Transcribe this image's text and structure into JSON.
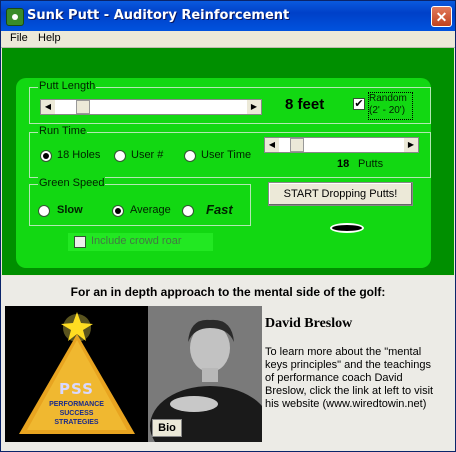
{
  "window": {
    "title": "Sunk Putt - Auditory Reinforcement",
    "close": "✕"
  },
  "menu": {
    "file": "File",
    "help": "Help"
  },
  "putt_length": {
    "group_label": "Putt Length",
    "value_text": "8 feet",
    "slider_fraction": 0.12,
    "random_label_line1": "Random",
    "random_label_line2": "(2' - 20')",
    "random_checked": true
  },
  "run_time": {
    "group_label": "Run Time",
    "options": [
      "18 Holes",
      "User #",
      "User Time"
    ],
    "selected": "18 Holes",
    "putts_count": "18",
    "putts_label": "Putts",
    "slider_fraction": 0.1
  },
  "green_speed": {
    "group_label": "Green Speed",
    "slow": "Slow",
    "average": "Average",
    "fast": "Fast",
    "selected": "Average"
  },
  "start_button": "START Dropping Putts!",
  "crowd_roar": {
    "label": "Include crowd roar",
    "checked": false
  },
  "promo": {
    "headline": "For an in depth approach to the mental side of the golf:",
    "logo_line1": "PSS",
    "logo_line2": "PERFORMANCE",
    "logo_line3": "SUCCESS",
    "logo_line4": "STRATEGIES",
    "bio_button": "Bio",
    "name": "David Breslow",
    "description": "To learn more about the \"mental keys principles\" and the teachings of performance coach David Breslow, click the link at left to visit his website (www.wiredtowin.net)"
  },
  "colors": {
    "fairway": "#008f00",
    "green": "#12d812",
    "titlebar": "#0052de"
  }
}
